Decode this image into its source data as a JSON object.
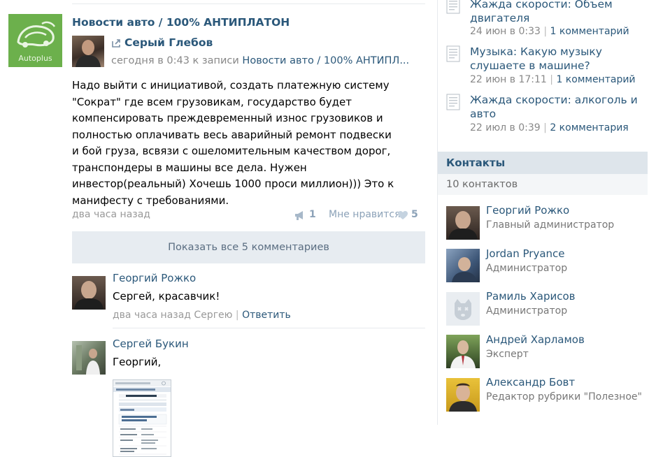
{
  "post": {
    "group_logo_text": "Autoplus",
    "title": "Новости авто / 100% АНТИПЛАТОН",
    "repost_author": "Серый Глебов",
    "repost_time": "сегодня в 0:43",
    "repost_prefix": "к записи",
    "repost_target": "Новости авто / 100% АНТИПЛ...",
    "text": "Надо выйти с инициативой, создать платежную систему \"Сократ\" где всем грузовикам, государство будет компенсировать преждевременный износ грузовиков и полностью оплачивать весь аварийный ремонт подвески и бой груза, всвязи с ошеломительным качеством дорог, транспондеры в машины все дела. Нужен инвестор(реальный) Хочешь 1000 проси миллион))) Это к манифесту с требованиями.",
    "time": "два часа назад",
    "share_count": "1",
    "like_label": "Мне нравится",
    "like_count": "5",
    "share_icon": "megaphone-icon",
    "like_icon": "heart-icon",
    "show_comments_label": "Показать все 5 комментариев"
  },
  "comments": [
    {
      "author": "Георгий Рожко",
      "text": "Сергей, красавчик!",
      "time": "два часа назад Сергею",
      "separator": "|",
      "reply": "Ответить"
    },
    {
      "author": "Сергей Букин",
      "text": "Георгий,"
    }
  ],
  "sidebar": {
    "topics": [
      {
        "title": "Жажда скорости: Объем двигателя",
        "date": "24 июн в 0:33",
        "separator": "|",
        "comments": "1 комментарий"
      },
      {
        "title": "Музыка: Какую музыку слушаете в машине?",
        "date": "22 июн в 17:11",
        "separator": "|",
        "comments": "1 комментарий"
      },
      {
        "title": "Жажда скорости: алкоголь и авто",
        "date": "22 июл в 0:39",
        "separator": "|",
        "comments": "2 комментария"
      }
    ],
    "contacts_title": "Контакты",
    "contacts_count": "10 контактов",
    "contacts": [
      {
        "name": "Георгий Рожко",
        "role": "Главный администратор"
      },
      {
        "name": "Jordan Pryance",
        "role": "Администратор"
      },
      {
        "name": "Рамиль Харисов",
        "role": "Администратор"
      },
      {
        "name": "Андрей Харламов",
        "role": "Эксперт"
      },
      {
        "name": "Александр Бовт",
        "role": "Редактор рубрики \"Полезное\""
      }
    ]
  },
  "colors": {
    "link": "#2b587a",
    "muted": "#999999",
    "like": "#8ca2b8",
    "button_bg": "#e7ecf1",
    "header_bg": "#dee5eb",
    "logo_bg": "#6cb04c"
  }
}
